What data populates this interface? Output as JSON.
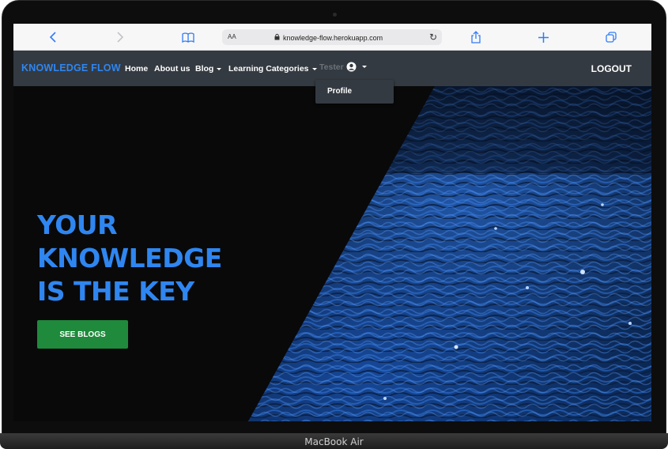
{
  "browser": {
    "text_size_label": "AA",
    "url": "knowledge-flow.herokuapp.com",
    "accent": "#2f7cf6"
  },
  "navbar": {
    "brand": "KNOWLEDGE FLOW",
    "items": [
      {
        "label": "Home",
        "has_caret": false
      },
      {
        "label": "About us",
        "has_caret": false
      },
      {
        "label": "Blog",
        "has_caret": true
      },
      {
        "label": "Learning Categories",
        "has_caret": true
      }
    ],
    "user": {
      "name": "Tester",
      "icon": "user-circle-icon"
    },
    "logout": "LOGOUT",
    "background": "#343a41",
    "brand_color": "#2f86f0"
  },
  "user_dropdown": {
    "items": [
      {
        "label": "Profile"
      }
    ]
  },
  "hero": {
    "headline": [
      "YOUR",
      "KNOWLEDGE",
      "IS THE KEY"
    ],
    "cta": "SEE BLOGS",
    "headline_color": "#2f86f0",
    "cta_color": "#1f8a3c"
  },
  "device": {
    "label": "MacBook Air"
  }
}
